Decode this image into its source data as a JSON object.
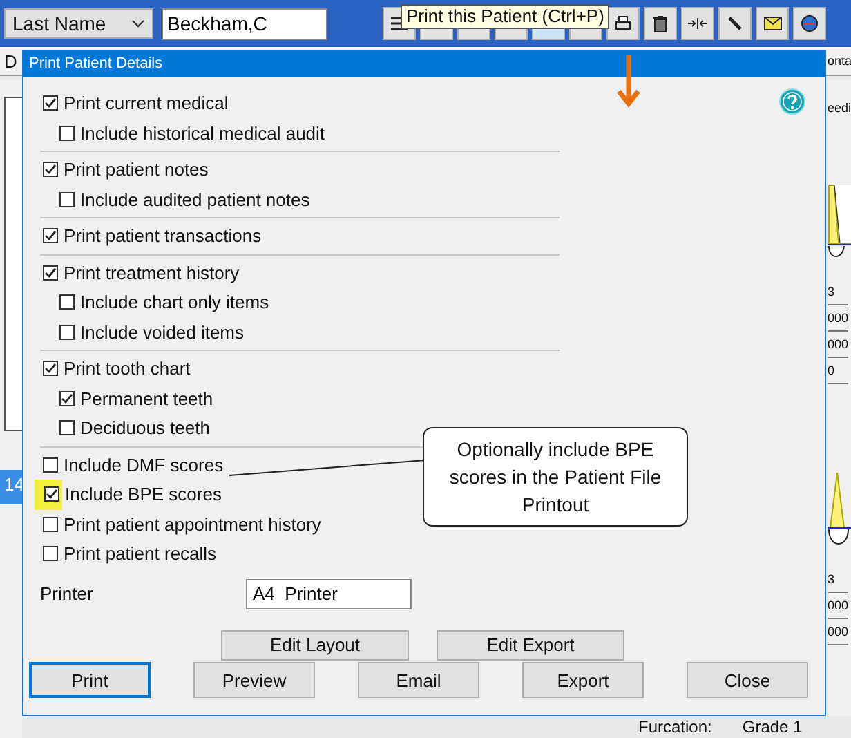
{
  "app": {
    "search_by": "Last Name",
    "search_value": "Beckham,C",
    "tooltip": "Print this Patient (Ctrl+P)",
    "left_tab": "D",
    "right_tab": "onta",
    "right_label": "eedi",
    "upper_chart": [
      "3",
      "000",
      "000",
      "0"
    ],
    "lower_chart": [
      "3",
      "000",
      "000"
    ],
    "list_row": "14",
    "furcation_label": "Furcation:",
    "furcation_value": "Grade 1"
  },
  "dialog": {
    "title": "Print Patient Details",
    "groups": [
      [
        {
          "label": "Print current medical",
          "checked": true,
          "highlighted": false,
          "children": [
            {
              "label": "Include historical medical audit",
              "checked": false,
              "highlighted": false
            }
          ]
        }
      ],
      [
        {
          "label": "Print patient notes",
          "checked": true,
          "highlighted": false,
          "children": [
            {
              "label": "Include audited patient notes",
              "checked": false,
              "highlighted": false
            }
          ]
        }
      ],
      [
        {
          "label": "Print patient transactions",
          "checked": true,
          "highlighted": false
        }
      ],
      [
        {
          "label": "Print treatment history",
          "checked": true,
          "highlighted": false,
          "children": [
            {
              "label": "Include chart only items",
              "checked": false,
              "highlighted": false
            },
            {
              "label": "Include voided items",
              "checked": false,
              "highlighted": false
            }
          ]
        }
      ],
      [
        {
          "label": "Print tooth chart",
          "checked": true,
          "highlighted": false,
          "children": [
            {
              "label": "Permanent teeth",
              "checked": true,
              "highlighted": false
            },
            {
              "label": "Deciduous teeth",
              "checked": false,
              "highlighted": false
            }
          ]
        }
      ],
      [
        {
          "label": "Include DMF scores",
          "checked": false,
          "highlighted": false
        },
        {
          "label": "Include BPE scores",
          "checked": true,
          "highlighted": true
        },
        {
          "label": "Print patient appointment history",
          "checked": false,
          "highlighted": false
        },
        {
          "label": "Print patient recalls",
          "checked": false,
          "highlighted": false
        }
      ]
    ],
    "printer_label": "Printer",
    "printer_value": "A4  Printer",
    "middle_buttons": [
      "Edit Layout",
      "Edit Export"
    ],
    "buttons": [
      {
        "label": "Print",
        "selected": true
      },
      {
        "label": "Preview",
        "selected": false
      },
      {
        "label": "Email",
        "selected": false
      },
      {
        "label": "Export",
        "selected": false
      },
      {
        "label": "Close",
        "selected": false
      }
    ],
    "callout": "Optionally include BPE scores in the Patient File Printout"
  }
}
